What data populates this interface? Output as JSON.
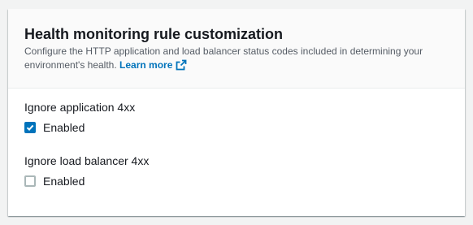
{
  "panel": {
    "title": "Health monitoring rule customization",
    "description": "Configure the HTTP application and load balancer status codes included in determining your environment's health.",
    "learn_more": "Learn more"
  },
  "fields": [
    {
      "label": "Ignore application 4xx",
      "checkbox_label": "Enabled",
      "checked": true
    },
    {
      "label": "Ignore load balancer 4xx",
      "checkbox_label": "Enabled",
      "checked": false
    }
  ],
  "colors": {
    "accent": "#0073bb",
    "text": "#16191f",
    "secondary_text": "#545b64",
    "checkbox_border": "#aab7b8"
  },
  "icons": {
    "learn_more": "external-link-icon",
    "checked": "check-icon"
  }
}
